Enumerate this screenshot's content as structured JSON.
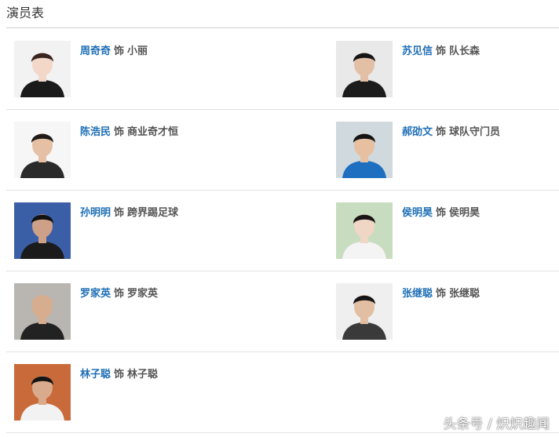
{
  "title": "演员表",
  "cast": [
    {
      "actor": "周奇奇",
      "sep": "饰",
      "role": "小丽",
      "bg": "#f2f2f2",
      "skin": "#f3d7c8",
      "hair": "#3a2420",
      "cloth": "#1a1a1a"
    },
    {
      "actor": "苏见信",
      "sep": "饰",
      "role": "队长森",
      "bg": "#e9e9e9",
      "skin": "#e3bfa6",
      "hair": "#161616",
      "cloth": "#1c1c1c"
    },
    {
      "actor": "陈浩民",
      "sep": "饰",
      "role": "商业奇才恒",
      "bg": "#f6f6f6",
      "skin": "#e6c0a4",
      "hair": "#1f1a18",
      "cloth": "#2a2a2a"
    },
    {
      "actor": "郝劭文",
      "sep": "饰",
      "role": "球队守门员",
      "bg": "#cfd9de",
      "skin": "#e6c0a0",
      "hair": "#141414",
      "cloth": "#1f6fc0"
    },
    {
      "actor": "孙明明",
      "sep": "饰",
      "role": "跨界踢足球",
      "bg": "#3b5fa6",
      "skin": "#cfa088",
      "hair": "#111111",
      "cloth": "#1b1b1b"
    },
    {
      "actor": "侯明昊",
      "sep": "饰",
      "role": "侯明昊",
      "bg": "#c8dcc0",
      "skin": "#f0d6c4",
      "hair": "#1a1416",
      "cloth": "#f4f4f4"
    },
    {
      "actor": "罗家英",
      "sep": "饰",
      "role": "罗家英",
      "bg": "#b9b6b2",
      "skin": "#d7ad90",
      "hair": "#d7ad90",
      "cloth": "#222222"
    },
    {
      "actor": "张继聪",
      "sep": "饰",
      "role": "张继聪",
      "bg": "#efefef",
      "skin": "#e2bea2",
      "hair": "#151515",
      "cloth": "#3a3a3a"
    },
    {
      "actor": "林子聪",
      "sep": "饰",
      "role": "林子聪",
      "bg": "#c96a3a",
      "skin": "#d9ab8c",
      "hair": "#141414",
      "cloth": "#f2f2f2"
    }
  ],
  "watermark": "头条号 / 炽炽趣闻"
}
